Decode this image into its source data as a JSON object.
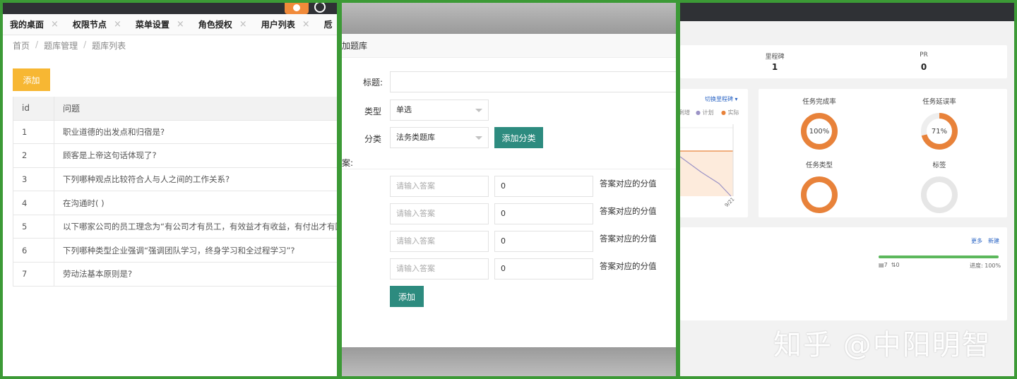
{
  "left": {
    "tabs": [
      {
        "label": "我的桌面"
      },
      {
        "label": "权限节点"
      },
      {
        "label": "菜单设置"
      },
      {
        "label": "角色授权"
      },
      {
        "label": "用户列表"
      },
      {
        "label": "卮"
      }
    ],
    "tab_close_glyph": "×",
    "breadcrumb": [
      "首页",
      "题库管理",
      "题库列表"
    ],
    "breadcrumb_sep": "/",
    "add_button": "添加",
    "table": {
      "headers": [
        "id",
        "问题"
      ],
      "rows": [
        {
          "id": "1",
          "question": "职业道德的出发点和归宿是?"
        },
        {
          "id": "2",
          "question": "顾客是上帝这句话体现了?"
        },
        {
          "id": "3",
          "question": "下列哪种观点比较符合人与人之间的工作关系?"
        },
        {
          "id": "4",
          "question": "在沟通时( )"
        },
        {
          "id": "5",
          "question": "以下哪家公司的员工理念为“有公司才有员工，有效益才有收益，有付出才有回"
        },
        {
          "id": "6",
          "question": "下列哪种类型企业强调“强调团队学习，终身学习和全过程学习”?"
        },
        {
          "id": "7",
          "question": "劳动法基本原则是?"
        }
      ]
    }
  },
  "middle": {
    "dialog_title": "加题库",
    "title_label": "标题:",
    "title_value": "",
    "type_label": "类型",
    "type_value": "单选",
    "category_label": "分类",
    "category_value": "法务类题库",
    "add_category_button": "添加分类",
    "answers_label": "案:",
    "answers": [
      {
        "placeholder": "请输入答案",
        "score": "0",
        "score_label": "答案对应的分值"
      },
      {
        "placeholder": "请输入答案",
        "score": "0",
        "score_label": "答案对应的分值"
      },
      {
        "placeholder": "请输入答案",
        "score": "0",
        "score_label": "答案对应的分值"
      },
      {
        "placeholder": "请输入答案",
        "score": "0",
        "score_label": "答案对应的分值"
      }
    ],
    "submit_button": "添加"
  },
  "right": {
    "stats": [
      {
        "label": "里程碑",
        "value": "1"
      },
      {
        "label": "PR",
        "value": "0"
      }
    ],
    "chart_switch": "切换里程碑",
    "chart_legend": [
      "剩增",
      "计划",
      "实际"
    ],
    "chart_tick": "9/21",
    "donuts": [
      {
        "title": "任务完成率",
        "percent": 100,
        "text": "100%",
        "color": "#e8823a"
      },
      {
        "title": "任务延误率",
        "percent": 71,
        "text": "71%",
        "color": "#e8823a"
      },
      {
        "title": "任务类型",
        "percent": 100,
        "text": "",
        "color": "#e8823a"
      },
      {
        "title": "标签",
        "percent": 0,
        "text": "",
        "color": "#e0e0e0"
      }
    ],
    "links": [
      "更多",
      "新建"
    ],
    "progress_value": 100,
    "task_stats": [
      "7",
      "0"
    ],
    "progress_text": "进度: 100%",
    "watermark": "知乎 @中阳明智"
  }
}
